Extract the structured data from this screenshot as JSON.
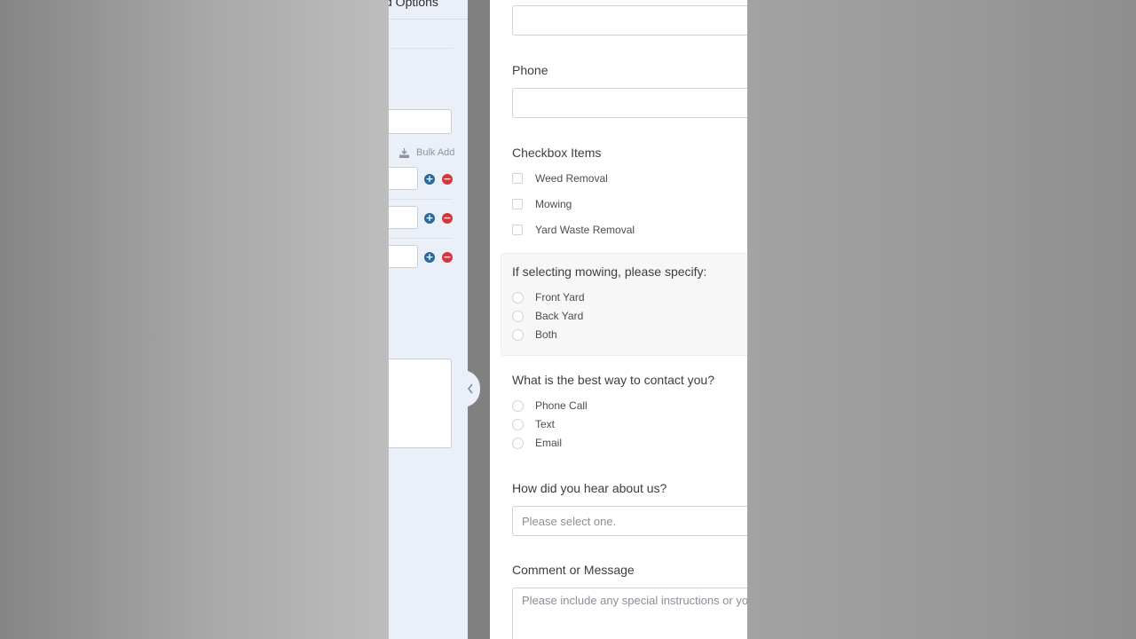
{
  "panel": {
    "title": "d Options",
    "bulk_add_label": "Bulk Add"
  },
  "form": {
    "phone_label": "Phone",
    "checkbox_label": "Checkbox Items",
    "checkbox_options": [
      "Weed Removal",
      "Mowing",
      "Yard Waste Removal"
    ],
    "mowing_label": "If selecting mowing, please specify:",
    "mowing_options": [
      "Front Yard",
      "Back Yard",
      "Both"
    ],
    "contact_label": "What is the best way to contact you?",
    "contact_options": [
      "Phone Call",
      "Text",
      "Email"
    ],
    "hear_label": "How did you hear about us?",
    "hear_placeholder": "Please select one.",
    "comment_label": "Comment or Message",
    "comment_placeholder": "Please include any special instructions or yo"
  },
  "icons": {
    "bulk_add": "download-icon",
    "add_option": "plus-circle-icon",
    "remove_option": "minus-circle-icon",
    "collapse": "chevron-left-icon"
  },
  "colors": {
    "panel_bg": "#ebf0f8",
    "add_button": "#2a6a9a",
    "remove_button": "#d0383e"
  }
}
